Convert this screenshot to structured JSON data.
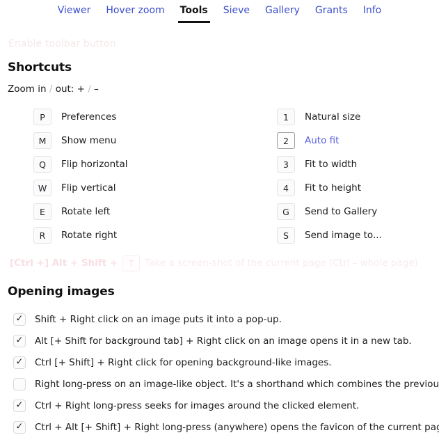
{
  "nav": {
    "items": [
      {
        "label": "Viewer",
        "active": false
      },
      {
        "label": "Hover zoom",
        "active": false
      },
      {
        "label": "Tools",
        "active": true
      },
      {
        "label": "Sieve",
        "active": false
      },
      {
        "label": "Gallery",
        "active": false
      },
      {
        "label": "Grants",
        "active": false
      },
      {
        "label": "Info",
        "active": false
      }
    ]
  },
  "disabled_notice": {
    "text": "Enable toolbar button"
  },
  "shortcuts": {
    "heading": "Shortcuts",
    "zoom_line": {
      "part1": "Zoom in",
      "sep1": "/",
      "part2": "out: +",
      "sep2": "/",
      "part3": "–"
    },
    "left_column": [
      {
        "key": "P",
        "desc": "Preferences"
      },
      {
        "key": "M",
        "desc": "Show menu"
      },
      {
        "key": "Q",
        "desc": "Flip horizontal"
      },
      {
        "key": "W",
        "desc": "Flip vertical"
      },
      {
        "key": "E",
        "desc": "Rotate left"
      },
      {
        "key": "R",
        "desc": "Rotate right"
      }
    ],
    "right_column": [
      {
        "key": "1",
        "desc": "Natural size",
        "accent": false
      },
      {
        "key": "2",
        "desc": "Auto fit",
        "accent": true
      },
      {
        "key": "3",
        "desc": "Fit to width",
        "accent": false
      },
      {
        "key": "4",
        "desc": "Fit to height",
        "accent": false
      },
      {
        "key": "G",
        "desc": "Send to Gallery",
        "accent": false
      },
      {
        "key": "S",
        "desc": "Send image to...",
        "accent": false
      }
    ],
    "screenshot_row": {
      "modifiers": "[Ctrl +] Alt + Shift +",
      "key": "T",
      "desc": "Take a screen-shot of the current page (Ctrl – whole page)"
    }
  },
  "opening_images": {
    "heading": "Opening images",
    "items": [
      {
        "checked": true,
        "tick": "✓",
        "label": "Shift + Right click on an image puts it into a pop-up."
      },
      {
        "checked": true,
        "tick": "✓",
        "label": "Alt [+ Shift for background tab] + Right click on an image opens it in a new tab."
      },
      {
        "checked": true,
        "tick": "✓",
        "label": "Ctrl [+ Shift] + Right click for opening background-like images."
      },
      {
        "checked": false,
        "tick": "",
        "label": "Right long-press on an image-like object. It's a shorthand which combines the previous two."
      },
      {
        "checked": true,
        "tick": "✓",
        "label": "Ctrl + Right long-press seeks for images around the clicked element."
      },
      {
        "checked": true,
        "tick": "✓",
        "label": "Ctrl + Alt [+ Shift] + Right long-press (anywhere) opens the favicon of the current page."
      }
    ]
  },
  "colors": {
    "link": "#3b4ecc",
    "accent": "#5a5ee0",
    "text": "#1c1c1c",
    "faded": "#f5e7e9",
    "keycap_border": "#e2e3e5"
  }
}
